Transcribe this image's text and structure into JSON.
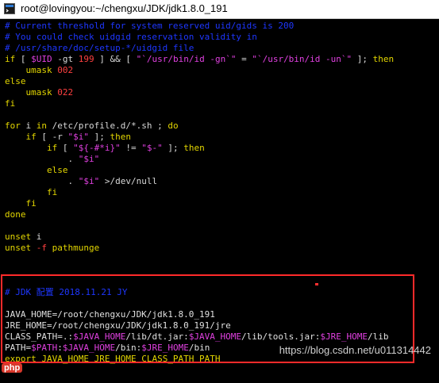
{
  "window": {
    "title": "root@lovingyou:~/chengxu/JDK/jdk1.8.0_191"
  },
  "terminal": {
    "lines": [
      {
        "segments": [
          {
            "t": "# Current threshold for system reserved uid/gids is 200",
            "c": "c-comment"
          }
        ]
      },
      {
        "segments": [
          {
            "t": "# You could check uidgid reservation validity in",
            "c": "c-comment"
          }
        ]
      },
      {
        "segments": [
          {
            "t": "# /usr/share/doc/setup-*/uidgid file",
            "c": "c-comment"
          }
        ]
      },
      {
        "segments": [
          {
            "t": "if",
            "c": "c-keyword"
          },
          {
            "t": " [ ",
            "c": "c-plain"
          },
          {
            "t": "$UID",
            "c": "c-var"
          },
          {
            "t": " -gt ",
            "c": "c-plain"
          },
          {
            "t": "199",
            "c": "c-num"
          },
          {
            "t": " ] && [ ",
            "c": "c-plain"
          },
          {
            "t": "\"`/usr/bin/id -gn`\"",
            "c": "c-str"
          },
          {
            "t": " = ",
            "c": "c-plain"
          },
          {
            "t": "\"`/usr/bin/id -un`\"",
            "c": "c-str"
          },
          {
            "t": " ]; ",
            "c": "c-plain"
          },
          {
            "t": "then",
            "c": "c-keyword"
          }
        ]
      },
      {
        "segments": [
          {
            "t": "    umask ",
            "c": "c-keyword"
          },
          {
            "t": "002",
            "c": "c-num"
          }
        ]
      },
      {
        "segments": [
          {
            "t": "else",
            "c": "c-keyword"
          }
        ]
      },
      {
        "segments": [
          {
            "t": "    umask ",
            "c": "c-keyword"
          },
          {
            "t": "022",
            "c": "c-num"
          }
        ]
      },
      {
        "segments": [
          {
            "t": "fi",
            "c": "c-keyword"
          }
        ]
      },
      {
        "segments": [
          {
            "t": "",
            "c": "c-plain"
          }
        ]
      },
      {
        "segments": [
          {
            "t": "for",
            "c": "c-keyword"
          },
          {
            "t": " i ",
            "c": "c-plain"
          },
          {
            "t": "in",
            "c": "c-keyword"
          },
          {
            "t": " /etc/profile.d/*.sh ; ",
            "c": "c-plain"
          },
          {
            "t": "do",
            "c": "c-keyword"
          }
        ]
      },
      {
        "segments": [
          {
            "t": "    if",
            "c": "c-keyword"
          },
          {
            "t": " [ -r ",
            "c": "c-plain"
          },
          {
            "t": "\"$i\"",
            "c": "c-str"
          },
          {
            "t": " ]; ",
            "c": "c-plain"
          },
          {
            "t": "then",
            "c": "c-keyword"
          }
        ]
      },
      {
        "segments": [
          {
            "t": "        if",
            "c": "c-keyword"
          },
          {
            "t": " [ ",
            "c": "c-plain"
          },
          {
            "t": "\"${-#*i}\"",
            "c": "c-str"
          },
          {
            "t": " != ",
            "c": "c-plain"
          },
          {
            "t": "\"$-\"",
            "c": "c-str"
          },
          {
            "t": " ]; ",
            "c": "c-plain"
          },
          {
            "t": "then",
            "c": "c-keyword"
          }
        ]
      },
      {
        "segments": [
          {
            "t": "            . ",
            "c": "c-plain"
          },
          {
            "t": "\"$i\"",
            "c": "c-str"
          }
        ]
      },
      {
        "segments": [
          {
            "t": "        else",
            "c": "c-keyword"
          }
        ]
      },
      {
        "segments": [
          {
            "t": "            . ",
            "c": "c-plain"
          },
          {
            "t": "\"$i\"",
            "c": "c-str"
          },
          {
            "t": " >/dev/null",
            "c": "c-plain"
          }
        ]
      },
      {
        "segments": [
          {
            "t": "        fi",
            "c": "c-keyword"
          }
        ]
      },
      {
        "segments": [
          {
            "t": "    fi",
            "c": "c-keyword"
          }
        ]
      },
      {
        "segments": [
          {
            "t": "done",
            "c": "c-keyword"
          }
        ]
      },
      {
        "segments": [
          {
            "t": "",
            "c": "c-plain"
          }
        ]
      },
      {
        "segments": [
          {
            "t": "unset",
            "c": "c-keyword"
          },
          {
            "t": " i",
            "c": "c-plain"
          }
        ]
      },
      {
        "segments": [
          {
            "t": "unset",
            "c": "c-keyword"
          },
          {
            "t": " -f",
            "c": "c-num"
          },
          {
            "t": " pathmunge",
            "c": "c-keyword"
          }
        ]
      },
      {
        "segments": [
          {
            "t": "",
            "c": "c-plain"
          }
        ]
      },
      {
        "segments": [
          {
            "t": "",
            "c": "c-plain"
          }
        ]
      },
      {
        "segments": [
          {
            "t": "",
            "c": "c-plain"
          }
        ]
      },
      {
        "segments": [
          {
            "t": "# JDK 配置 2018.11.21 JY",
            "c": "c-comment"
          }
        ]
      },
      {
        "segments": [
          {
            "t": "",
            "c": "c-plain"
          }
        ]
      },
      {
        "segments": [
          {
            "t": "JAVA_HOME=/root/chengxu/JDK/jdk1.8.0_191",
            "c": "c-path"
          }
        ]
      },
      {
        "segments": [
          {
            "t": "JRE_HOME=/root/chengxu/JDK/jdk1.8.0_191/jre",
            "c": "c-path"
          }
        ]
      },
      {
        "segments": [
          {
            "t": "CLASS_PATH=.:",
            "c": "c-path"
          },
          {
            "t": "$JAVA_HOME",
            "c": "c-var"
          },
          {
            "t": "/lib/dt.jar:",
            "c": "c-path"
          },
          {
            "t": "$JAVA_HOME",
            "c": "c-var"
          },
          {
            "t": "/lib/tools.jar:",
            "c": "c-path"
          },
          {
            "t": "$JRE_HOME",
            "c": "c-var"
          },
          {
            "t": "/lib",
            "c": "c-path"
          }
        ]
      },
      {
        "segments": [
          {
            "t": "PATH=",
            "c": "c-path"
          },
          {
            "t": "$PATH",
            "c": "c-var"
          },
          {
            "t": ":",
            "c": "c-path"
          },
          {
            "t": "$JAVA_HOME",
            "c": "c-var"
          },
          {
            "t": "/bin:",
            "c": "c-path"
          },
          {
            "t": "$JRE_HOME",
            "c": "c-var"
          },
          {
            "t": "/bin",
            "c": "c-path"
          }
        ]
      },
      {
        "segments": [
          {
            "t": "export",
            "c": "c-keyword"
          },
          {
            "t": " JAVA_HOME JRE_HOME CLASS_PATH PATH",
            "c": "c-keyword"
          }
        ]
      }
    ]
  },
  "watermark": "https://blog.csdn.net/u011314442",
  "badge": "php",
  "colors": {
    "comment": "#1e37ff",
    "keyword": "#e3d600",
    "string": "#e040e0",
    "number": "#ff4040",
    "highlight_box": "#ff2a2a"
  }
}
